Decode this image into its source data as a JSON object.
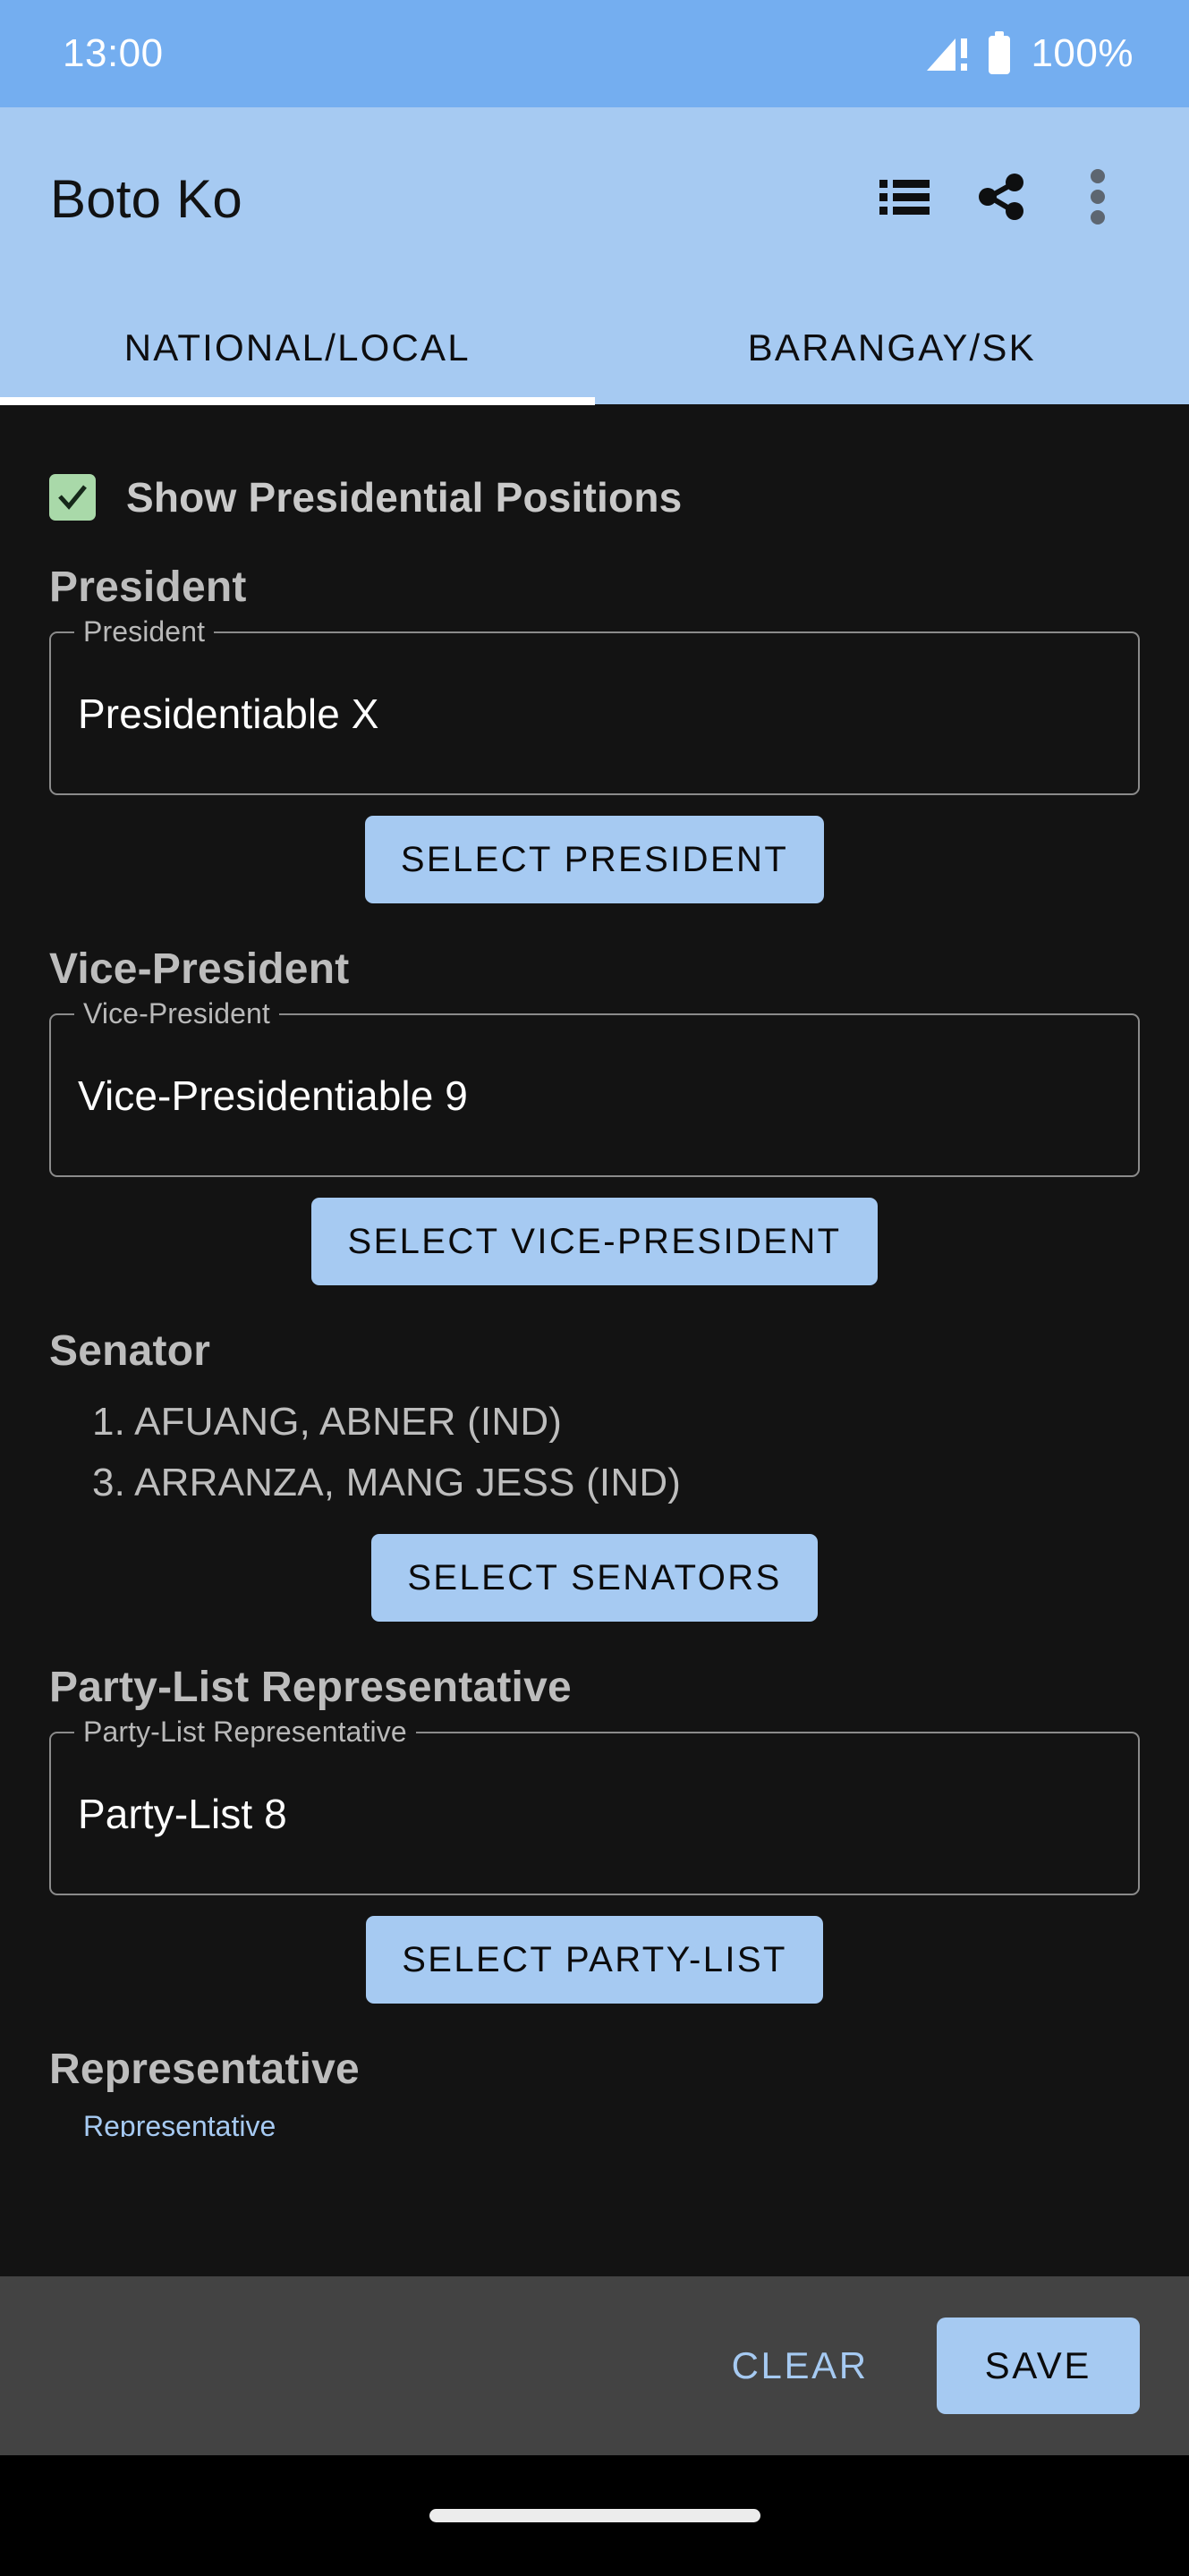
{
  "status_bar": {
    "clock": "13:00",
    "battery_text": "100%",
    "signal_icon": "signal-warning-icon",
    "battery_icon": "battery-full-icon"
  },
  "app_bar": {
    "title": "Boto Ko",
    "actions": [
      {
        "name": "view-list-icon",
        "label": "View list"
      },
      {
        "name": "share-icon",
        "label": "Share"
      },
      {
        "name": "overflow-menu-icon",
        "label": "More options"
      }
    ]
  },
  "tabs": [
    {
      "label": "NATIONAL/LOCAL",
      "selected": true
    },
    {
      "label": "BARANGAY/SK",
      "selected": false
    }
  ],
  "content": {
    "show_presidential": {
      "label": "Show Presidential Positions",
      "checked": true
    },
    "president": {
      "heading": "President",
      "field_label": "President",
      "value": "Presidentiable X",
      "button": "SELECT PRESIDENT"
    },
    "vice_president": {
      "heading": "Vice-President",
      "field_label": "Vice-President",
      "value": "Vice-Presidentiable 9",
      "button": "SELECT VICE-PRESIDENT"
    },
    "senator": {
      "heading": "Senator",
      "items": [
        "1. AFUANG, ABNER (IND)",
        "3. ARRANZA, MANG JESS (IND)"
      ],
      "button": "SELECT SENATORS"
    },
    "party_list": {
      "heading": "Party-List Representative",
      "field_label": "Party-List Representative",
      "value": "Party-List 8",
      "button": "SELECT PARTY-LIST"
    },
    "representative": {
      "heading": "Representative",
      "field_label_partial": "Representative"
    }
  },
  "bottom_bar": {
    "clear": "CLEAR",
    "save": "SAVE"
  },
  "colors": {
    "status_bar": "#74aef0",
    "app_bar": "#a6caf2",
    "accent": "#a6caf2",
    "background": "#131313",
    "bottom_bar": "#434343",
    "checkbox": "#a9d9a9"
  }
}
